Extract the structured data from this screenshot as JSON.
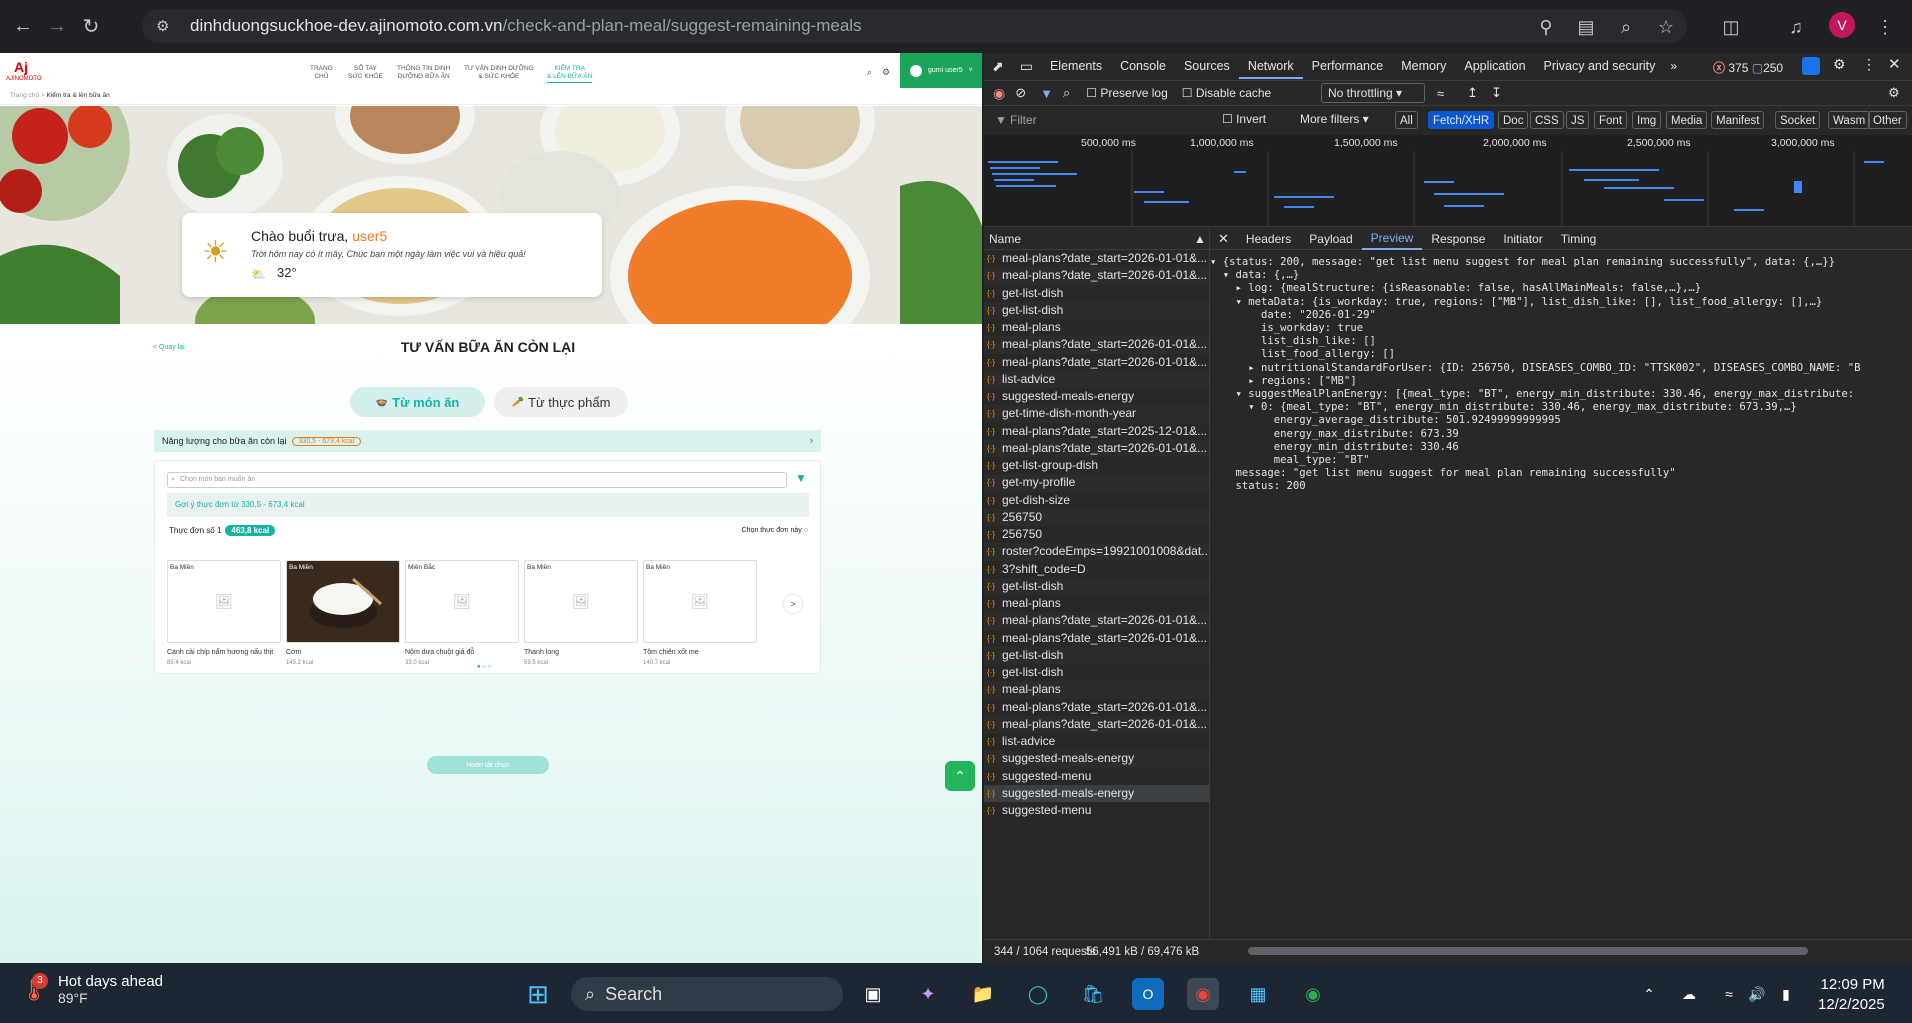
{
  "browser": {
    "url_domain": "dinhduongsuckhoe-dev.ajinomoto.com.vn",
    "url_path": "/check-and-plan-meal/suggest-remaining-meals",
    "profile_initial": "V"
  },
  "site": {
    "logo_text": "AJINOMOTO",
    "logo_mark": "Aj",
    "menu": [
      {
        "line1": "TRANG",
        "line2": "CHỦ"
      },
      {
        "line1": "SỔ TAY",
        "line2": "SỨC KHỎE"
      },
      {
        "line1": "THÔNG TIN DINH",
        "line2": "DƯỠNG BỮA ĂN"
      },
      {
        "line1": "TƯ VẤN DINH DƯỠNG",
        "line2": "& SỨC KHỎE"
      },
      {
        "line1": "KIỂM TRA",
        "line2": "& LÊN BỮA ĂN"
      }
    ],
    "user_label": "gumi user5",
    "breadcrumb_home": "Trang chủ",
    "breadcrumb_current": "Kiểm tra & lên bữa ăn"
  },
  "greeting": {
    "title": "Chào buổi trưa, ",
    "username": "user5",
    "subtitle": "Trời hôm nay có ít mây. Chúc bạn một ngày làm việc vui và hiệu quả!",
    "temperature": "32°"
  },
  "content": {
    "back_label": "Quay lại",
    "title": "TƯ VẤN BỮA ĂN CÒN LẠI",
    "tab_dish": "Từ món ăn",
    "tab_food": "Từ thực phẩm",
    "energy_label": "Năng lượng cho bữa ăn còn lại",
    "energy_range": "330,5 - 673,4 kcal",
    "search_placeholder": "Chọn món bạn muốn ăn",
    "suggest_note": "Gợi ý thực đơn từ 330,5 - 673,4 kcal",
    "menu_label": "Thực đơn số 1",
    "menu_kcal": "463,8 kcal",
    "choose_label": "Chọn thực đơn này",
    "finish_label": "Hoàn tất chọn",
    "dishes": [
      {
        "region": "Ba Miền",
        "name": "Canh cải chíp nấm hương nấu thịt",
        "kcal": "85,4 kcal"
      },
      {
        "region": "Ba Miền",
        "name": "Cơm",
        "kcal": "145,2 kcal"
      },
      {
        "region": "Miền Bắc",
        "name": "Nộm dưa chuột giá đỗ",
        "kcal": "33,0 kcal"
      },
      {
        "region": "Ba Miền",
        "name": "Thanh long",
        "kcal": "59,5 kcal"
      },
      {
        "region": "Ba Miền",
        "name": "Tôm chiên xốt me",
        "kcal": "140,7 kcal"
      }
    ]
  },
  "devtools": {
    "tabs": [
      "Elements",
      "Console",
      "Sources",
      "Network",
      "Performance",
      "Memory",
      "Application",
      "Privacy and security"
    ],
    "errors": "375",
    "warnings": "250",
    "preserve_log": "Preserve log",
    "disable_cache": "Disable cache",
    "throttling": "No throttling",
    "filter_placeholder": "Filter",
    "invert": "Invert",
    "more_filters": "More filters",
    "type_filters": [
      "All",
      "Fetch/XHR",
      "Doc",
      "CSS",
      "JS",
      "Font",
      "Img",
      "Media",
      "Manifest",
      "Socket",
      "Wasm",
      "Other"
    ],
    "timeline_labels": [
      "500,000 ms",
      "1,000,000 ms",
      "1,500,000 ms",
      "2,000,000 ms",
      "2,500,000 ms",
      "3,000,000 ms"
    ],
    "name_header": "Name",
    "requests": [
      "meal-plans?date_start=2026-01-01&...",
      "meal-plans?date_start=2026-01-01&...",
      "get-list-dish",
      "get-list-dish",
      "meal-plans",
      "meal-plans?date_start=2026-01-01&...",
      "meal-plans?date_start=2026-01-01&...",
      "list-advice",
      "suggested-meals-energy",
      "get-time-dish-month-year",
      "meal-plans?date_start=2025-12-01&...",
      "meal-plans?date_start=2026-01-01&...",
      "get-list-group-dish",
      "get-my-profile",
      "get-dish-size",
      "256750",
      "256750",
      "roster?codeEmps=19921001008&dat...",
      "3?shift_code=D",
      "get-list-dish",
      "meal-plans",
      "meal-plans?date_start=2026-01-01&...",
      "meal-plans?date_start=2026-01-01&...",
      "get-list-dish",
      "get-list-dish",
      "meal-plans",
      "meal-plans?date_start=2026-01-01&...",
      "meal-plans?date_start=2026-01-01&...",
      "list-advice",
      "suggested-meals-energy",
      "suggested-menu",
      "suggested-meals-energy",
      "suggested-menu"
    ],
    "detail_tabs": [
      "Headers",
      "Payload",
      "Preview",
      "Response",
      "Initiator",
      "Timing"
    ],
    "preview": [
      "▾ {status: 200, message: \"get list menu suggest for meal plan remaining successfully\", data: {,…}}",
      "  ▾ data: {,…}",
      "    ▸ log: {mealStructure: {isReasonable: false, hasAllMainMeals: false,…},…}",
      "    ▾ metaData: {is_workday: true, regions: [\"MB\"], list_dish_like: [], list_food_allergy: [],…}",
      "        date: \"2026-01-29\"",
      "        is_workday: true",
      "        list_dish_like: []",
      "        list_food_allergy: []",
      "      ▸ nutritionalStandardForUser: {ID: 256750, DISEASES_COMBO_ID: \"TTSK002\", DISEASES_COMBO_NAME: \"B",
      "      ▸ regions: [\"MB\"]",
      "    ▾ suggestMealPlanEnergy: [{meal_type: \"BT\", energy_min_distribute: 330.46, energy_max_distribute:",
      "      ▾ 0: {meal_type: \"BT\", energy_min_distribute: 330.46, energy_max_distribute: 673.39,…}",
      "          energy_average_distribute: 501.92499999999995",
      "          energy_max_distribute: 673.39",
      "          energy_min_distribute: 330.46",
      "          meal_type: \"BT\"",
      "    message: \"get list menu suggest for meal plan remaining successfully\"",
      "    status: 200"
    ],
    "status_requests": "344 / 1064 requests",
    "status_size": "56,491 kB / 69,476 kB"
  },
  "taskbar": {
    "weather_title": "Hot days ahead",
    "weather_temp": "89°F",
    "weather_badge": "3",
    "search_label": "Search",
    "time": "12:09 PM",
    "date": "12/2/2025"
  },
  "colors": {
    "accent": "#17b2a4",
    "orange": "#f07b1f",
    "devtools_bg": "#282828",
    "taskbar_bg": "#1c2733"
  }
}
